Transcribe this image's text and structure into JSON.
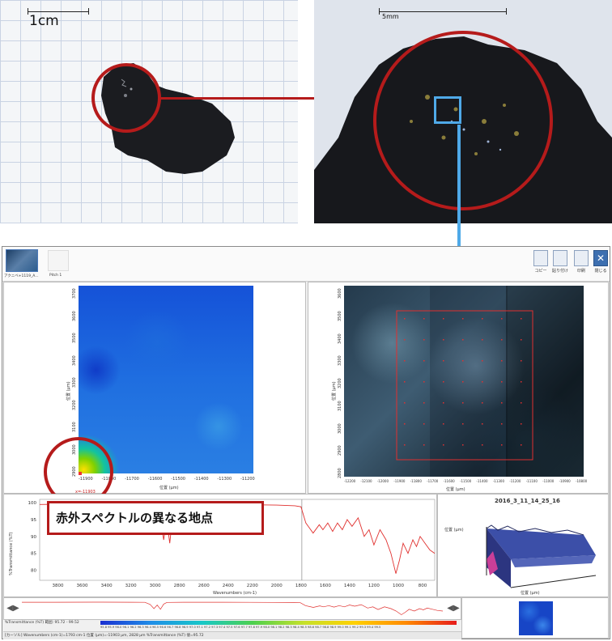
{
  "photos": {
    "left_scale_label": "1cm",
    "right_scale_label": "5mm"
  },
  "toolbar": {
    "thumb1_label": "アクニベ+1119_A...",
    "thumb2_label": "Pitch 1",
    "buttons": [
      {
        "label": "コピー",
        "icon": "copy-icon"
      },
      {
        "label": "貼り付け",
        "icon": "paste-icon"
      },
      {
        "label": "印刷",
        "icon": "print-icon"
      },
      {
        "label": "閉じる",
        "icon": "close-icon"
      }
    ]
  },
  "heatmap": {
    "y_axis_label": "位置 (μm)",
    "x_axis_label": "位置 (μm)",
    "y_ticks": [
      "3700",
      "3600",
      "3500",
      "3400",
      "3300",
      "3200",
      "3100",
      "3000",
      "2900"
    ],
    "x_ticks": [
      "-11900",
      "-11800",
      "-11700",
      "-11600",
      "-11500",
      "-11400",
      "-11300",
      "-11200"
    ],
    "marker_label": "x=-11903"
  },
  "microscope": {
    "y_axis_label": "位置 (μm)",
    "x_axis_label": "位置 (μm)",
    "y_ticks": [
      "3600",
      "3500",
      "3400",
      "3300",
      "3200",
      "3100",
      "3000",
      "2900",
      "2800"
    ],
    "x_ticks": [
      "-12200",
      "-12100",
      "-12000",
      "-11900",
      "-11800",
      "-11700",
      "-11600",
      "-11500",
      "-11400",
      "-11300",
      "-11200",
      "-11100",
      "-11000",
      "-10900",
      "-10800"
    ]
  },
  "spectrum": {
    "y_axis_label": "%Transmittance (%T)",
    "x_axis_label": "Wavenumbers (cm-1)"
  },
  "surface": {
    "title": "2016_3_11_14_25_16",
    "axis_label_1": "位置 (μm)",
    "axis_label_2": "位置 (μm)"
  },
  "callout": {
    "text": "赤外スペクトルの異なる地点"
  },
  "bottom": {
    "legend_label": "%Transmittance (%T) 範囲: 95.72 - 99.52",
    "colorbar_ticks": "95.8 95.9 96.0 96.1 96.2 96.3 96.4 96.5 96.6 96.7 96.8 96.9 97.0 97.1 97.2 97.3 97.4 97.5 97.6 97.7 97.8 97.9 98.0 98.1 98.2 98.3 98.4 98.5 98.6 98.7 98.8 98.9 99.0 99.1 99.2 99.3 99.4 99.5",
    "status_text": "[カーソル] Wavenumbers (cm-1)=1793 cm-1 位置 (μm)=-11903 μm, 2828 μm %Transmittance (%T) 値=95.72"
  },
  "chart_data": [
    {
      "type": "line",
      "title": "",
      "xlabel": "Wavenumbers (cm-1)",
      "ylabel": "%Transmittance (%T)",
      "x_ticks": [
        3800,
        3600,
        3400,
        3200,
        3000,
        2800,
        2600,
        2400,
        2200,
        2000,
        1800,
        1600,
        1400,
        1200,
        1000,
        800
      ],
      "y_ticks": [
        80,
        85,
        90,
        95,
        100
      ],
      "xlim": [
        3950,
        700
      ],
      "ylim": [
        77,
        101
      ],
      "series": [
        {
          "x": [
            3950,
            3700,
            3400,
            3100,
            3000,
            2960,
            2930,
            2905,
            2880,
            2855,
            2830,
            2700,
            2400,
            2200,
            2000,
            1850,
            1800,
            1760,
            1700,
            1650,
            1620,
            1580,
            1540,
            1500,
            1460,
            1420,
            1380,
            1330,
            1280,
            1240,
            1200,
            1150,
            1100,
            1060,
            1020,
            990,
            960,
            920,
            880,
            850,
            820,
            780,
            740,
            700
          ],
          "values": [
            99.5,
            99.6,
            99.7,
            99.6,
            99.4,
            96.0,
            89.0,
            95.0,
            88.0,
            96.5,
            99.2,
            99.5,
            99.5,
            99.4,
            99.3,
            99.1,
            98.8,
            94.0,
            91.0,
            93.5,
            92.0,
            94.0,
            91.5,
            94.0,
            92.0,
            95.0,
            93.0,
            95.5,
            90.0,
            92.0,
            87.5,
            92.0,
            89.0,
            85.0,
            79.0,
            83.0,
            88.0,
            85.0,
            89.0,
            87.0,
            90.0,
            88.0,
            86.0,
            85.0
          ]
        }
      ]
    }
  ]
}
